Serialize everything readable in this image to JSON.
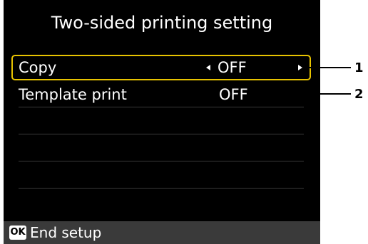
{
  "screen": {
    "title": "Two-sided printing setting"
  },
  "menu": {
    "items": [
      {
        "label": "Copy",
        "value": "OFF"
      },
      {
        "label": "Template print",
        "value": "OFF"
      }
    ]
  },
  "footer": {
    "ok_badge": "OK",
    "text": "End setup"
  },
  "callouts": [
    "1",
    "2"
  ],
  "colors": {
    "selection_border": "#e8c300",
    "screen_background": "#000000",
    "footer_background": "#3a3a3a"
  }
}
